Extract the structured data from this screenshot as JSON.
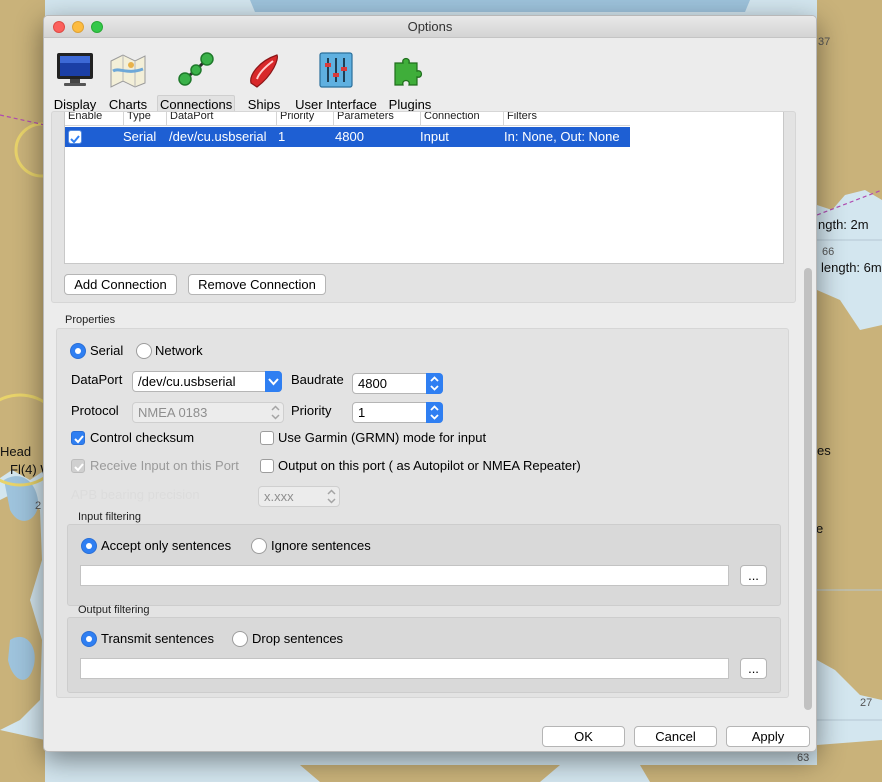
{
  "window": {
    "title": "Options"
  },
  "toolbar": {
    "items": [
      {
        "label": "Display",
        "icon": "display-icon"
      },
      {
        "label": "Charts",
        "icon": "charts-icon"
      },
      {
        "label": "Connections",
        "icon": "connections-icon",
        "selected": true
      },
      {
        "label": "Ships",
        "icon": "ships-icon"
      },
      {
        "label": "User Interface",
        "icon": "user-interface-icon"
      },
      {
        "label": "Plugins",
        "icon": "plugins-icon"
      }
    ]
  },
  "connections": {
    "headers": [
      "Enable",
      "Type",
      "DataPort",
      "Priority",
      "Parameters",
      "Connection",
      "Filters"
    ],
    "rows": [
      {
        "enabled": true,
        "type": "Serial",
        "dataport": "/dev/cu.usbserial",
        "priority": "1",
        "parameters": "4800",
        "connection": "Input",
        "filters": "In: None, Out: None"
      }
    ],
    "add_label": "Add Connection",
    "remove_label": "Remove Connection"
  },
  "properties": {
    "title": "Properties",
    "serial_label": "Serial",
    "network_label": "Network",
    "dataport_label": "DataPort",
    "dataport_value": "/dev/cu.usbserial",
    "baudrate_label": "Baudrate",
    "baudrate_value": "4800",
    "protocol_label": "Protocol",
    "protocol_value": "NMEA 0183",
    "priority_label": "Priority",
    "priority_value": "1",
    "checksum_label": "Control checksum",
    "garmin_label": "Use Garmin (GRMN) mode for input",
    "receive_label": "Receive Input on this Port",
    "output_label": "Output on this port ( as Autopilot or NMEA Repeater)",
    "apb_label": "APB bearing precision",
    "apb_value": "x.xxx"
  },
  "input_filtering": {
    "title": "Input filtering",
    "accept_label": "Accept only sentences",
    "ignore_label": "Ignore sentences",
    "more_label": "..."
  },
  "output_filtering": {
    "title": "Output filtering",
    "transmit_label": "Transmit sentences",
    "drop_label": "Drop sentences",
    "more_label": "..."
  },
  "buttons": {
    "ok": "OK",
    "cancel": "Cancel",
    "apply": "Apply"
  },
  "background_chart": {
    "labels": {
      "head": "Head",
      "light": "Fl(4) W",
      "length1": "ngth: 2m",
      "length2": "length: 6m",
      "es": "es",
      "e": "e"
    },
    "numbers": {
      "n37": "37",
      "n66": "66",
      "n2": "2",
      "n27": "27",
      "n63": "63"
    }
  },
  "colors": {
    "accent": "#2f7ff2",
    "selection": "#1e5fd3",
    "land": "#c9b27a",
    "water": "#d3e6ef",
    "deep_water": "#9ec3dc"
  }
}
